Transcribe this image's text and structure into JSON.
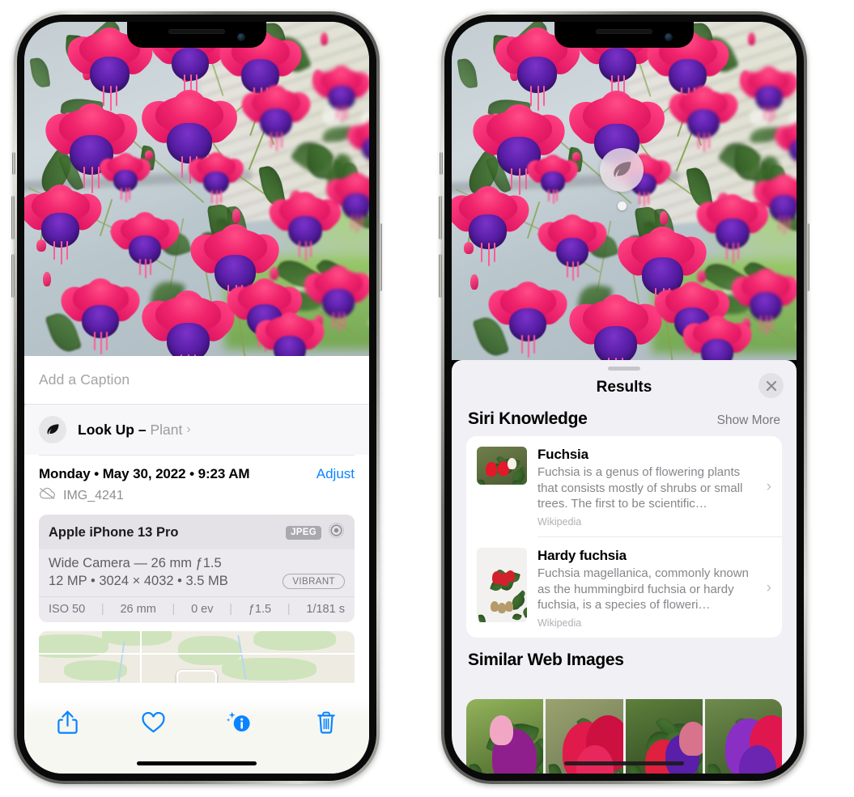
{
  "left_phone": {
    "caption_field": {
      "placeholder": "Add a Caption",
      "value": ""
    },
    "lookup_row": {
      "icon": "leaf-icon",
      "label": "Look Up – ",
      "subject": "Plant",
      "chevron": "›"
    },
    "metadata": {
      "date_line": "Monday • May 30, 2022 • 9:23 AM",
      "adjust_label": "Adjust",
      "cloud_icon": "icloud-slash-icon",
      "filename": "IMG_4241"
    },
    "exif": {
      "device": "Apple iPhone 13 Pro",
      "format_badge": "JPEG",
      "lens_icon": "camera-lens-icon",
      "lens_line": "Wide Camera — 26 mm ƒ1.5",
      "resolution_line": "12 MP • 3024 × 4032 • 3.5 MB",
      "style_badge": "VIBRANT",
      "stats": [
        "ISO 50",
        "26 mm",
        "0 ev",
        "ƒ1.5",
        "1/181 s"
      ]
    },
    "toolbar": [
      {
        "name": "share-button",
        "icon": "share-icon"
      },
      {
        "name": "favorite-button",
        "icon": "heart-icon"
      },
      {
        "name": "info-button",
        "icon": "info-sparkle-icon"
      },
      {
        "name": "delete-button",
        "icon": "trash-icon"
      }
    ]
  },
  "right_phone": {
    "badge": {
      "icon": "leaf-icon"
    },
    "sheet": {
      "title": "Results",
      "close_icon": "close-icon",
      "siri_section": {
        "title": "Siri Knowledge",
        "action": "Show More",
        "cards": [
          {
            "title": "Fuchsia",
            "description": "Fuchsia is a genus of flowering plants that consists mostly of shrubs or small trees. The first to be scientific…",
            "source": "Wikipedia",
            "chevron": "›"
          },
          {
            "title": "Hardy fuchsia",
            "description": "Fuchsia magellanica, commonly known as the hummingbird fuchsia or hardy fuchsia, is a species of floweri…",
            "source": "Wikipedia",
            "chevron": "›"
          }
        ]
      },
      "similar_section": {
        "title": "Similar Web Images",
        "thumbnails": [
          "web-image-1",
          "web-image-2",
          "web-image-3",
          "web-image-4"
        ]
      }
    }
  },
  "colors": {
    "accent_blue": "#0a84ff",
    "sheet_bg": "#f1f0f5",
    "card_bg": "#ffffff",
    "secondary_text": "#86868b"
  }
}
